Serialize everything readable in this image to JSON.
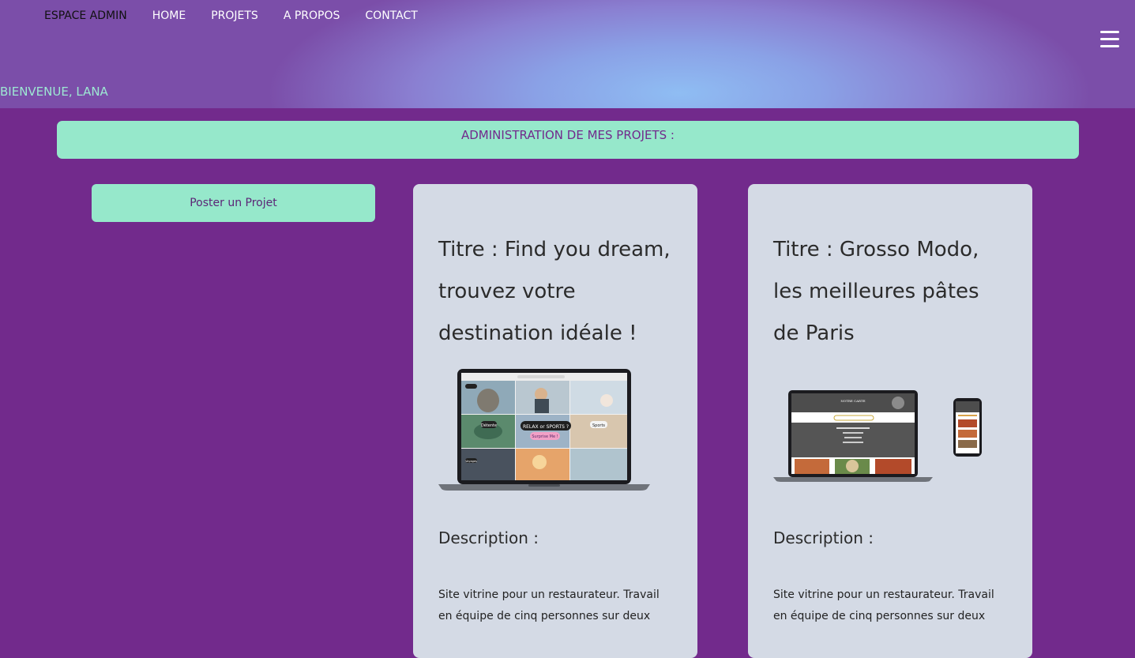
{
  "nav": {
    "admin": "ESPACE ADMIN",
    "home": "HOME",
    "projets": "PROJETS",
    "apropos": "A PROPOS",
    "contact": "CONTACT"
  },
  "welcome": "BIENVENUE, LANA",
  "banner": "ADMINISTRATION DE MES PROJETS :",
  "post_button": "Poster un Projet",
  "projects": [
    {
      "title": "Titre : Find you dream, trouvez votre destination idéale !",
      "image_icon": "laptop-mockup-travel-site",
      "screen_labels": [
        "RELAX or SPORTS ?",
        "Surprise Me !",
        "Détente",
        "Sports",
        "Voyages"
      ],
      "description_label": "Description :",
      "description": "Site vitrine pour un restaurateur. Travail en équipe de cinq personnes sur deux"
    },
    {
      "title": "Titre : Grosso Modo, les meilleures pâtes de Paris",
      "image_icon": "laptop-and-phone-mockup-restaurant-site",
      "screen_labels": [
        "NOTRE CARTE"
      ],
      "description_label": "Description :",
      "description": "Site vitrine pour un restaurateur. Travail en équipe de cinq personnes sur deux"
    }
  ],
  "colors": {
    "background": "#722a8c",
    "accent": "#96e8cb",
    "card": "#d4dae5",
    "welcome_text": "#9de8d3"
  }
}
